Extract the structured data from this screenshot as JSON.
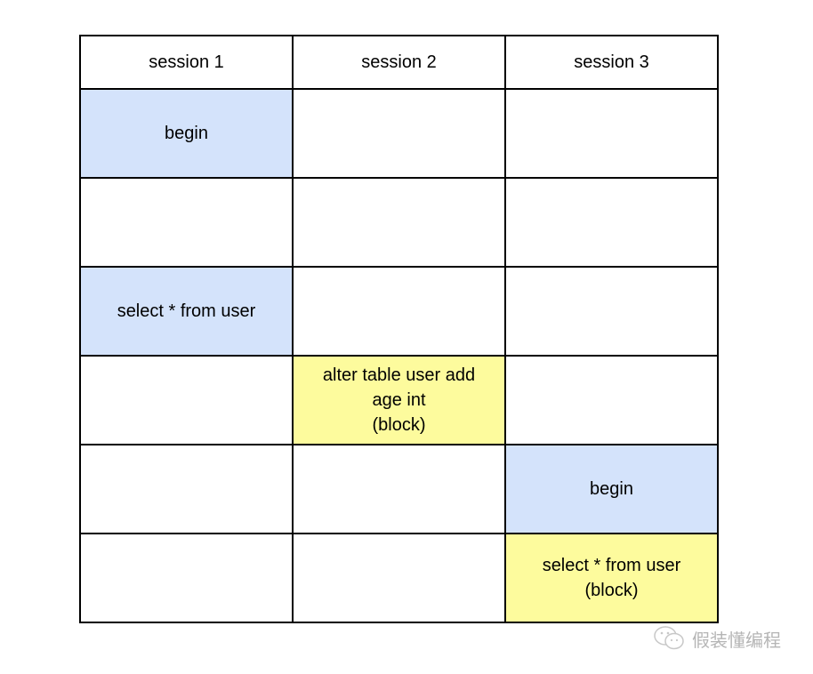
{
  "headers": [
    "session 1",
    "session 2",
    "session 3"
  ],
  "rows": [
    [
      {
        "text": "begin",
        "color": "blue"
      },
      {
        "text": "",
        "color": ""
      },
      {
        "text": "",
        "color": ""
      }
    ],
    [
      {
        "text": "",
        "color": ""
      },
      {
        "text": "",
        "color": ""
      },
      {
        "text": "",
        "color": ""
      }
    ],
    [
      {
        "text": "select * from user",
        "color": "blue"
      },
      {
        "text": "",
        "color": ""
      },
      {
        "text": "",
        "color": ""
      }
    ],
    [
      {
        "text": "",
        "color": ""
      },
      {
        "text": "alter table user add\nage int\n(block)",
        "color": "yellow"
      },
      {
        "text": "",
        "color": ""
      }
    ],
    [
      {
        "text": "",
        "color": ""
      },
      {
        "text": "",
        "color": ""
      },
      {
        "text": "begin",
        "color": "blue"
      }
    ],
    [
      {
        "text": "",
        "color": ""
      },
      {
        "text": "",
        "color": ""
      },
      {
        "text": "select * from user\n(block)",
        "color": "yellow"
      }
    ]
  ],
  "colors": {
    "blue": "#d4e3fb",
    "yellow": "#fdfb9d"
  },
  "watermark": {
    "icon": "wechat-icon",
    "text": "假装懂编程"
  }
}
